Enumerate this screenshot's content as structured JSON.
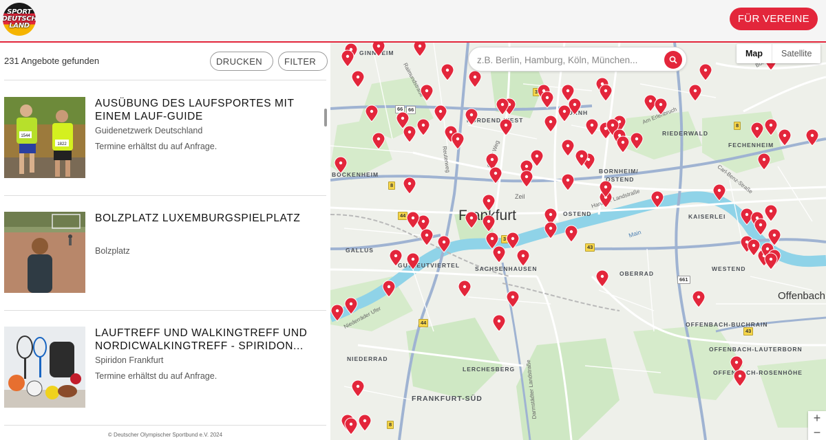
{
  "header": {
    "logo_text": "SPORT\nDEUTSCH\nLAND",
    "cta_label": "FÜR VEREINE"
  },
  "list_panel": {
    "result_count": "231 Angebote gefunden",
    "print_label": "DRUCKEN",
    "filter_label": "FILTER",
    "items": [
      {
        "title": "AUSÜBUNG DES LAUFSPORTES MIT EINEM LAUF-GUIDE",
        "organization": "Guidenetzwerk Deutschland",
        "note": "Termine erhältst du auf Anfrage.",
        "bib_numbers": [
          "1544",
          "1822"
        ]
      },
      {
        "title": "BOLZPLATZ LUXEMBURGSPIELPLATZ",
        "organization": "",
        "note": "Bolzplatz"
      },
      {
        "title": "LAUFTREFF UND WALKINGTREFF UND NORDICWALKINGTREFF - SPIRIDON...",
        "organization": "Spiridon Frankfurt",
        "note": "Termine erhältst du auf Anfrage."
      }
    ],
    "footer": "© Deutscher Olympischer Sportbund e.V. 2024"
  },
  "map": {
    "search_placeholder": "z.B. Berlin, Hamburg, Köln, München...",
    "map_type_options": [
      "Map",
      "Satellite"
    ],
    "map_type_selected": "Map",
    "zoom_in": "+",
    "zoom_out": "−",
    "labels": {
      "city": "Frankfurt",
      "offenbach": "Offenbach",
      "districts": [
        "GINNHEIM",
        "NORDEND-WEST",
        "BORNHEIM/",
        "OSTEND",
        "BOCKENHEIM",
        "GALLUS",
        "SACHSENHAUSEN",
        "OBERRAD",
        "KAISERLEI",
        "WESTEND",
        "OFFENBACH-BUCHRAIN",
        "OFFENBACH-LAUTERBORN",
        "OFFENBACH-ROSENHÖHE",
        "NIEDERRAD",
        "LERCHESBERG",
        "FRANKFURT-SÜD",
        "FECHENHEIM",
        "RIEDERWALD",
        "BORNH",
        "OSTEND",
        "Zeil",
        "GUTLEUTVIERTEL"
      ],
      "streets": [
        "Raimundstraße",
        "Reuterweg",
        "Oeder Weg",
        "Hanauer Landstraße",
        "Carl-Benz-Straße",
        "Borsigallee",
        "Niederräder Ufer",
        "Darmstädter Landstraße",
        "Am Erlenbruch",
        "Main"
      ],
      "shields": [
        "66",
        "3",
        "8",
        "44",
        "43",
        "661",
        "8",
        "3",
        "66",
        "43",
        "44",
        "8"
      ]
    }
  },
  "colors": {
    "brand_red": "#e3263b",
    "water": "#8fd3e8",
    "park": "#cfe8c4",
    "road": "#ffffff",
    "highway": "#9fb3d2"
  }
}
